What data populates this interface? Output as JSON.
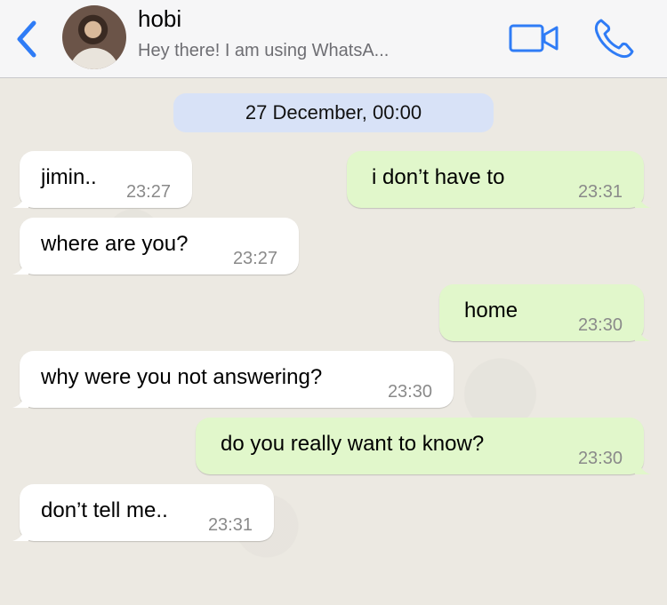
{
  "header": {
    "contact_name": "hobi",
    "status": "Hey there! I am using WhatsA...",
    "back_icon": "chevron-left-icon",
    "video_icon": "video-camera-icon",
    "phone_icon": "phone-icon",
    "accent_color": "#2f7cf6"
  },
  "chat": {
    "date_label": "27 December, 00:00",
    "messages": [
      {
        "dir": "in",
        "text": "jimin..",
        "time": "23:27"
      },
      {
        "dir": "out",
        "text": "i don’t have to",
        "time": "23:31"
      },
      {
        "dir": "in",
        "text": "where are you?",
        "time": "23:27"
      },
      {
        "dir": "out",
        "text": "home",
        "time": "23:30"
      },
      {
        "dir": "in",
        "text": "why were you not answering?",
        "time": "23:30"
      },
      {
        "dir": "out",
        "text": "do you really want to know?",
        "time": "23:30"
      },
      {
        "dir": "in",
        "text": "don’t tell me..",
        "time": "23:31"
      }
    ],
    "incoming_bubble_color": "#ffffff",
    "outgoing_bubble_color": "#e1f7cb"
  }
}
